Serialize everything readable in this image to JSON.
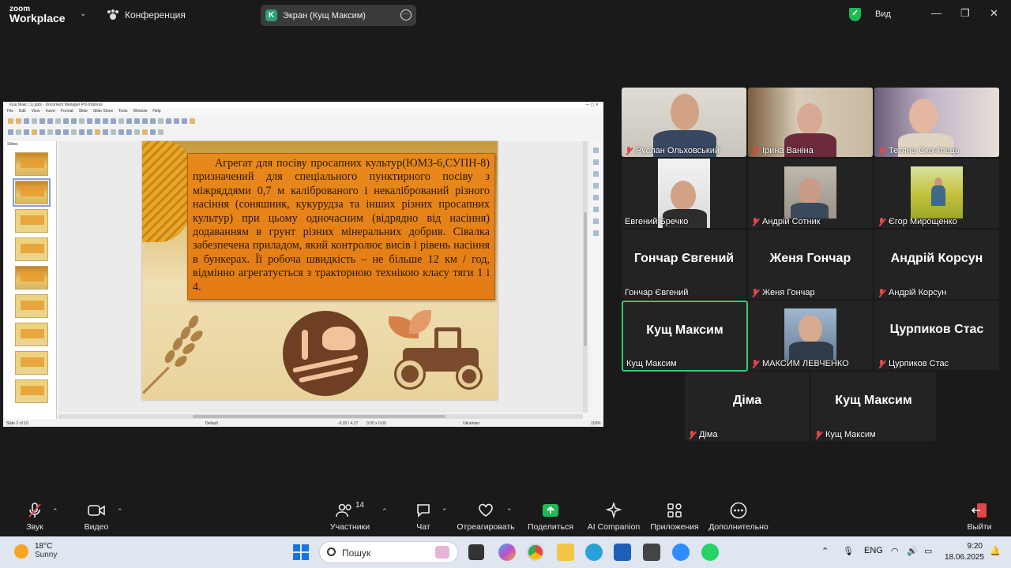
{
  "topbar": {
    "logo_line1": "zoom",
    "logo_line2": "Workplace",
    "conference_label": "Конференция",
    "share_initial": "K",
    "share_label": "Экран (Кущ Максим)",
    "view_label": "Вид"
  },
  "shared_app": {
    "title": "Кущ Макс (1).pptx - Document Manager Pro Impress",
    "menu": [
      "File",
      "Edit",
      "View",
      "Insert",
      "Format",
      "Slide",
      "Slide Show",
      "Tools",
      "Window",
      "Help"
    ],
    "slides_header": "Slides",
    "slide_text": "Агрегат для посіву просапних культур(ЮМЗ-6,СУПН-8) призначений для спеціального пунктирного посіву з міжряддями 0,7 м каліброваного і некалібрований різного насіння (соняшник, кукурудза та інших різних просапних культур) при цьому одночасним (відрядно від насіння) додаванням в грунт різних мінеральних добрив. Сівалка забезпечена приладом, який контролює висів і рівень насіння в бункерах. Її робоча швидкість – не більше 12 км / год, відмінно агрегатується з тракторною технікою класу тяги 1 і 4.",
    "status": {
      "slide": "Slide 2 of 10",
      "layout": "Default",
      "coords": "-6,03 / 4,17",
      "size": "0,00 x 0,00",
      "lang": "Ukrainian",
      "zoom": "118%"
    }
  },
  "participants": [
    {
      "name": "Руслан Ольховський",
      "muted": true,
      "video": true
    },
    {
      "name": "Ірина Ваніна",
      "muted": true,
      "video": true
    },
    {
      "name": "Тетяна Скочілець",
      "muted": true,
      "video": true
    },
    {
      "name": "Евгений Бречко",
      "muted": false,
      "video": true
    },
    {
      "name": "Андрій Сотник",
      "muted": true,
      "video": true
    },
    {
      "name": "Єгор Мирощенко",
      "muted": true,
      "video": true
    },
    {
      "name": "Гончар Євгений",
      "display": "Гончар Євгений",
      "muted": false,
      "video": false
    },
    {
      "name": "Женя Гончар",
      "display": "Женя Гончар",
      "muted": true,
      "video": false
    },
    {
      "name": "Андрій Корсун",
      "display": "Андрій Корсун",
      "muted": true,
      "video": false
    },
    {
      "name": "Кущ Максим",
      "display": "Кущ Максим",
      "muted": false,
      "video": false,
      "active": true
    },
    {
      "name": "МАКСИМ ЛЕВЧЕНКО",
      "muted": true,
      "video": true
    },
    {
      "name": "Цурпиков Стас",
      "display": "Цурпиков Стас",
      "muted": true,
      "video": false
    },
    {
      "name": "Діма",
      "display": "Діма",
      "muted": true,
      "video": false
    },
    {
      "name": "Кущ Максим",
      "display": "Кущ Максим",
      "muted": true,
      "video": false
    }
  ],
  "toolbar": {
    "audio": "Звук",
    "video": "Видео",
    "participants": "Участники",
    "participants_count": "14",
    "chat": "Чат",
    "react": "Отреагировать",
    "share": "Поделиться",
    "ai": "AI Companion",
    "apps": "Приложения",
    "more": "Дополнительно",
    "leave": "Выйти"
  },
  "taskbar": {
    "temp": "18°C",
    "weather": "Sunny",
    "search_placeholder": "Пошук",
    "lang": "ENG",
    "time": "9:20",
    "date": "18.06.2025"
  }
}
